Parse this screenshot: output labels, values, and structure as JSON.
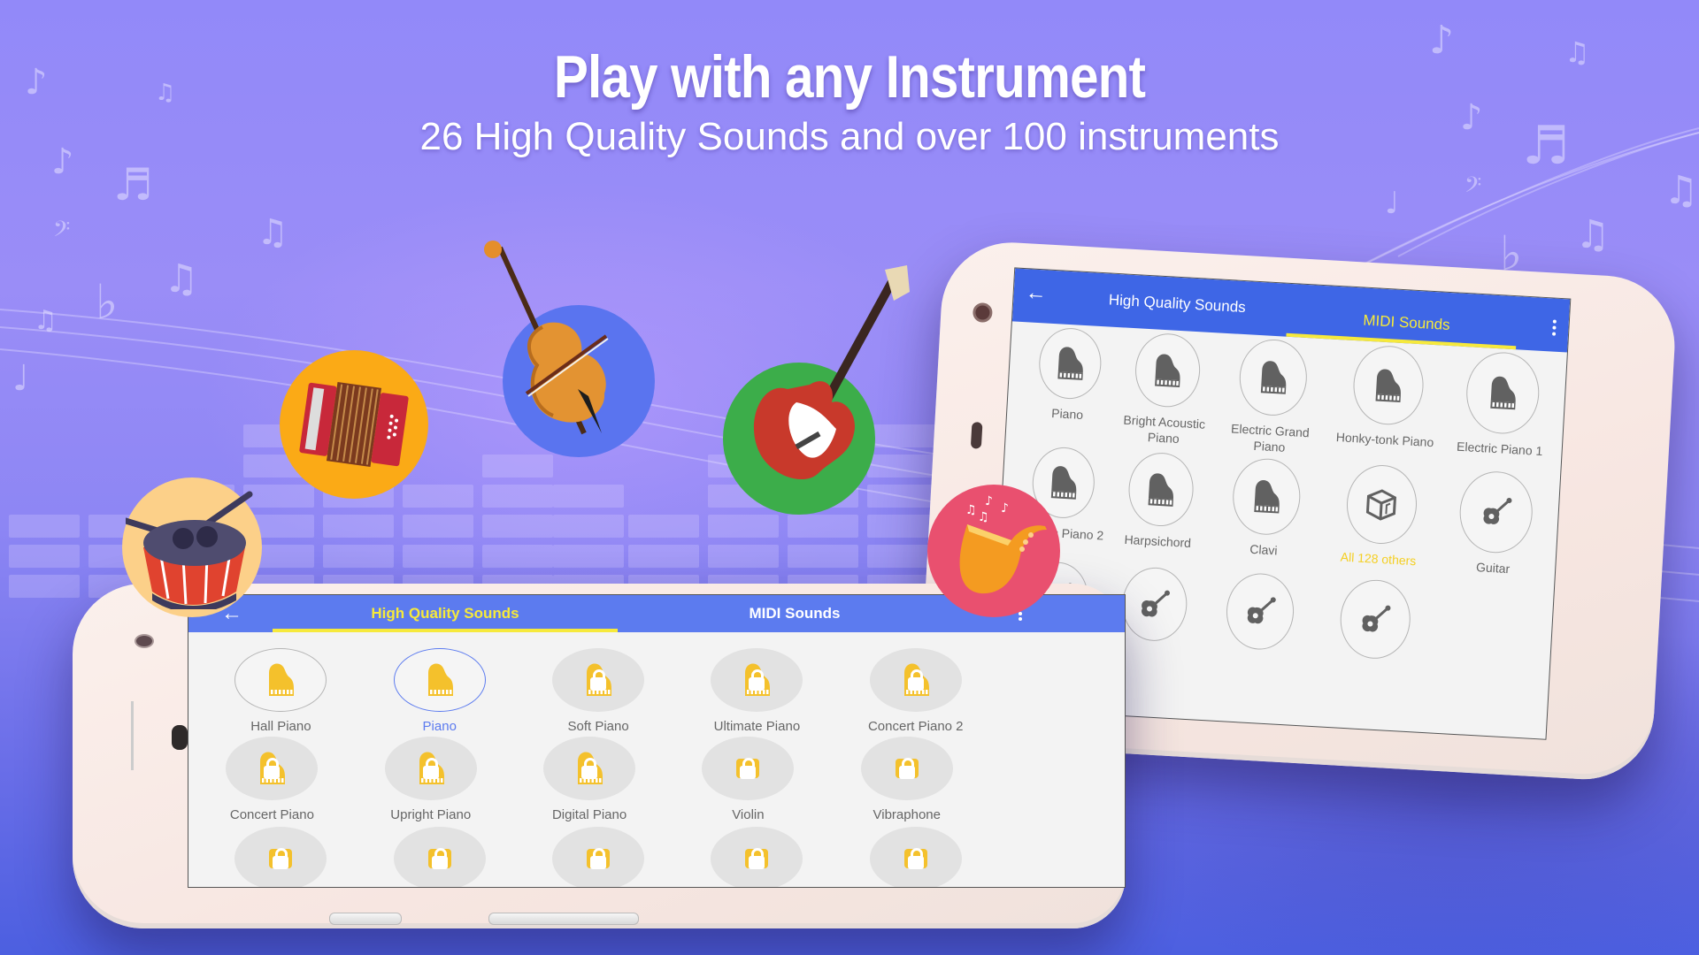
{
  "headline": {
    "title": "Play with any Instrument",
    "subtitle": "26 High Quality Sounds and over 100 instruments"
  },
  "colors": {
    "appbar_light": "#5c7bef",
    "appbar_dark": "#3e66e6",
    "tab_active": "#f6ea3a",
    "icon_gold": "#f4c12c",
    "icon_gray": "#616161",
    "accent_label": "#f4cf22"
  },
  "badges": [
    {
      "name": "drum",
      "icon": "drum-icon",
      "color": "#fcd089"
    },
    {
      "name": "accordion",
      "icon": "accordion-icon",
      "color": "#fbaa16"
    },
    {
      "name": "cello",
      "icon": "cello-icon",
      "color": "#5a74ef"
    },
    {
      "name": "electric-guitar",
      "icon": "electric-guitar-icon",
      "color": "#3cad4a"
    },
    {
      "name": "saxophone",
      "icon": "saxophone-icon",
      "color": "#e9506f"
    }
  ],
  "phone_front": {
    "back_icon": "arrow-left-icon",
    "tabs": [
      {
        "label": "High Quality Sounds",
        "active": true
      },
      {
        "label": "MIDI Sounds",
        "active": false
      }
    ],
    "menu_icon": "more-vertical-icon",
    "items": [
      {
        "label": "Hall Piano",
        "icon": "grand-piano-icon",
        "state": "unlocked"
      },
      {
        "label": "Piano",
        "icon": "grand-piano-icon",
        "state": "selected"
      },
      {
        "label": "Soft Piano",
        "icon": "grand-piano-icon",
        "state": "locked"
      },
      {
        "label": "Ultimate Piano",
        "icon": "grand-piano-icon",
        "state": "locked"
      },
      {
        "label": "Concert Piano 2",
        "icon": "grand-piano-icon",
        "state": "locked"
      },
      {
        "label": "Concert Piano",
        "icon": "grand-piano-icon",
        "state": "locked"
      },
      {
        "label": "Upright Piano",
        "icon": "grand-piano-icon",
        "state": "locked"
      },
      {
        "label": "Digital Piano",
        "icon": "grand-piano-icon",
        "state": "locked"
      },
      {
        "label": "Violin",
        "icon": "violin-icon",
        "state": "locked"
      },
      {
        "label": "Vibraphone",
        "icon": "vibraphone-icon",
        "state": "locked"
      },
      {
        "label": "",
        "icon": "trumpet-icon",
        "state": "locked"
      },
      {
        "label": "",
        "icon": "horn-icon",
        "state": "locked"
      },
      {
        "label": "",
        "icon": "organ-icon",
        "state": "locked"
      },
      {
        "label": "",
        "icon": "synth-icon",
        "state": "locked"
      },
      {
        "label": "",
        "icon": "maracas-icon",
        "state": "locked"
      }
    ]
  },
  "phone_back": {
    "back_icon": "arrow-left-icon",
    "tabs": [
      {
        "label": "High Quality Sounds",
        "active": false
      },
      {
        "label": "MIDI Sounds",
        "active": true
      }
    ],
    "menu_icon": "more-vertical-icon",
    "items": [
      {
        "label": "Piano",
        "icon": "grand-piano-icon"
      },
      {
        "label": "Bright Acoustic Piano",
        "icon": "grand-piano-icon"
      },
      {
        "label": "Electric Grand Piano",
        "icon": "grand-piano-icon"
      },
      {
        "label": "Honky-tonk Piano",
        "icon": "grand-piano-icon"
      },
      {
        "label": "Electric Piano 1",
        "icon": "grand-piano-icon"
      },
      {
        "label": "Electric Piano 2",
        "icon": "grand-piano-icon"
      },
      {
        "label": "Harpsichord",
        "icon": "grand-piano-icon"
      },
      {
        "label": "Clavi",
        "icon": "grand-piano-icon"
      },
      {
        "label": "All 128 others",
        "icon": "music-box-icon",
        "accent": true
      },
      {
        "label": "Guitar",
        "icon": "acoustic-guitar-icon"
      },
      {
        "label": "",
        "icon": "acoustic-guitar-icon"
      },
      {
        "label": "",
        "icon": "acoustic-guitar-icon"
      },
      {
        "label": "",
        "icon": "acoustic-guitar-icon"
      },
      {
        "label": "",
        "icon": "acoustic-guitar-icon"
      }
    ]
  }
}
